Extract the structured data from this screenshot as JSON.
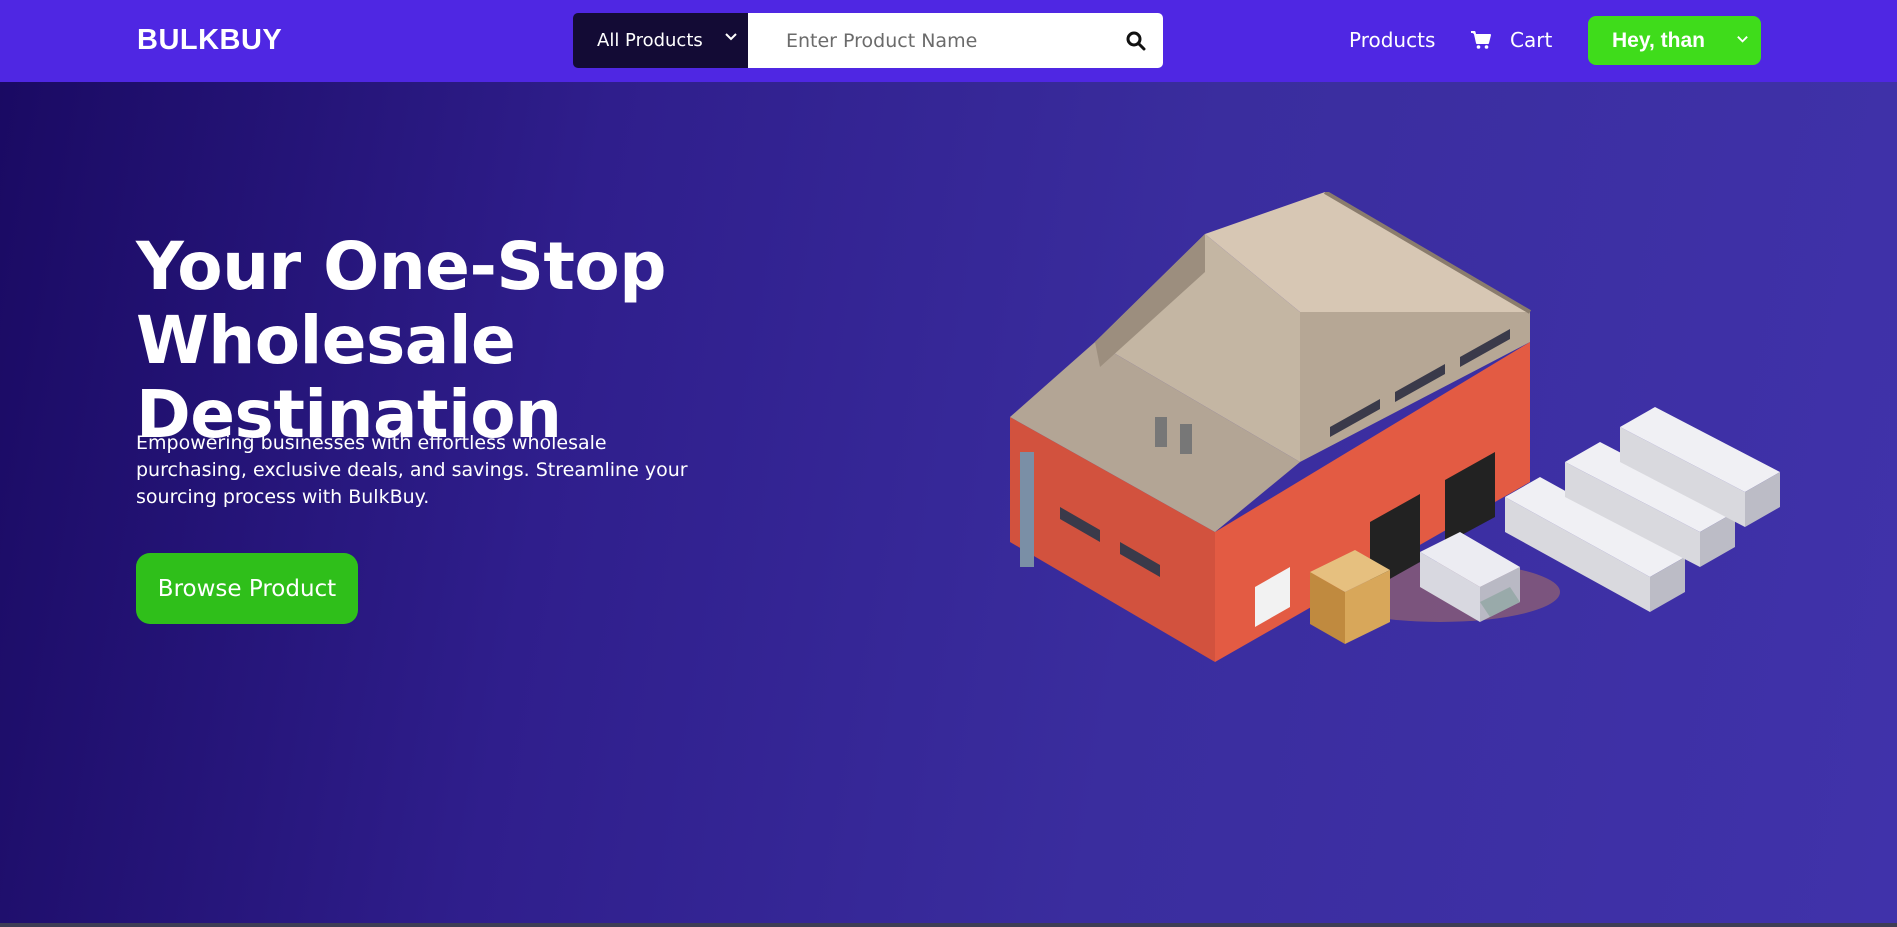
{
  "navbar": {
    "brand": "BULKBUY",
    "search": {
      "category_selected": "All Products",
      "placeholder": "Enter Product Name",
      "icon": "search-icon"
    },
    "links": {
      "products": "Products",
      "cart": "Cart"
    },
    "user_menu": "Hey, than"
  },
  "hero": {
    "title_line1": "Your One-Stop Wholesale",
    "title_line2": "Destination",
    "description": "Empowering businesses with effortless wholesale purchasing, exclusive deals, and savings. Streamline your sourcing process with BulkBuy.",
    "cta_label": "Browse Product"
  },
  "colors": {
    "navbar": "#4f27e3",
    "accent_green": "#3fdc1b",
    "cta_green": "#2fbf1a",
    "search_category_bg": "#130b35",
    "hero_gradient_start": "#1a0a63",
    "hero_gradient_end": "#4032aa"
  }
}
